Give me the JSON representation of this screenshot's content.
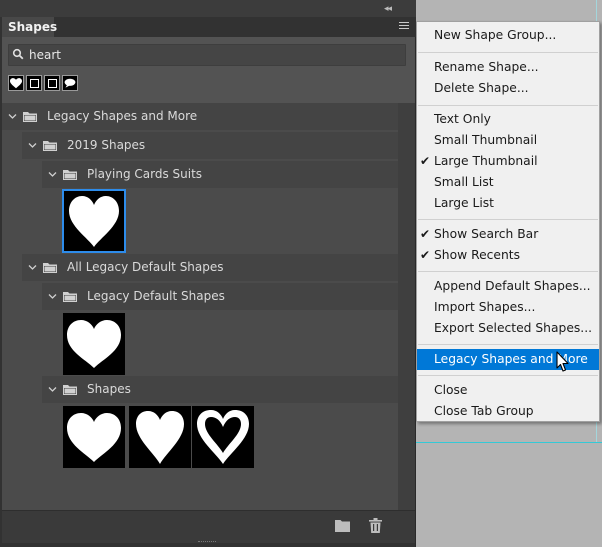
{
  "panel": {
    "tab_label": "Shapes",
    "collapse_glyph": "◂◂",
    "menu_icon": "hamburger-icon"
  },
  "search": {
    "value": "heart",
    "placeholder": ""
  },
  "recents": [
    "heart-icon",
    "square-icon",
    "square-icon",
    "speech-bubble-icon"
  ],
  "tree": {
    "root": "Legacy Shapes and More",
    "group_2019": "2019 Shapes",
    "playing_cards": "Playing Cards Suits",
    "all_legacy": "All Legacy Default Shapes",
    "legacy_default": "Legacy Default Shapes",
    "shapes": "Shapes"
  },
  "menu": {
    "new_shape_group": "New Shape Group...",
    "rename_shape": "Rename Shape...",
    "delete_shape": "Delete Shape...",
    "text_only": "Text Only",
    "small_thumbnail": "Small Thumbnail",
    "large_thumbnail": "Large Thumbnail",
    "small_list": "Small List",
    "large_list": "Large List",
    "show_search_bar": "Show Search Bar",
    "show_recents": "Show Recents",
    "append_default": "Append Default Shapes...",
    "import_shapes": "Import Shapes...",
    "export_selected": "Export Selected Shapes...",
    "legacy_shapes": "Legacy Shapes and More",
    "close": "Close",
    "close_tab_group": "Close Tab Group",
    "checkmark": "✔"
  },
  "colors": {
    "accent": "#0078d7",
    "selection": "#2d8ceb",
    "guide": "#34c9d6"
  }
}
